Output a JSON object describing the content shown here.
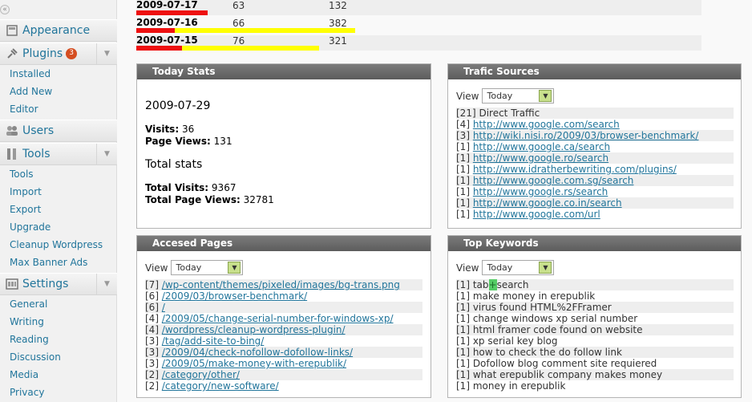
{
  "sidebar": {
    "collapse_icon": "«",
    "menus": [
      {
        "label": "Appearance",
        "icon": "appearance-icon"
      },
      {
        "label": "Plugins",
        "icon": "plugins-icon",
        "badge": "3"
      },
      {
        "label": "Users",
        "icon": "users-icon"
      },
      {
        "label": "Tools",
        "icon": "tools-icon"
      },
      {
        "label": "Settings",
        "icon": "settings-icon"
      }
    ],
    "plugins_sub": [
      "Installed",
      "Add New",
      "Editor"
    ],
    "tools_sub": [
      "Tools",
      "Import",
      "Export",
      "Upgrade",
      "Cleanup Wordpress",
      "Max Banner Ads"
    ],
    "settings_sub": [
      "General",
      "Writing",
      "Reading",
      "Discussion",
      "Media",
      "Privacy"
    ]
  },
  "daily_rows": [
    {
      "date": "2009-07-17",
      "visits": "63",
      "views": "132",
      "visits_frac": 0.195,
      "views_frac": 0.195
    },
    {
      "date": "2009-07-16",
      "visits": "66",
      "views": "382",
      "visits_frac": 0.105,
      "views_frac": 0.6
    },
    {
      "date": "2009-07-15",
      "visits": "76",
      "views": "321",
      "visits_frac": 0.125,
      "views_frac": 0.5
    }
  ],
  "today": {
    "title": "Today Stats",
    "date": "2009-07-29",
    "visits_label": "Visits:",
    "visits": "36",
    "views_label": "Page Views:",
    "views": "131",
    "total_heading": "Total stats",
    "total_visits_label": "Total Visits:",
    "total_visits": "9367",
    "total_views_label": "Total Page Views:",
    "total_views": "32781"
  },
  "traffic": {
    "title": "Trafic Sources",
    "view_label": "View",
    "select_value": "Today",
    "direct": "[21] Direct Traffic",
    "items": [
      {
        "count": "[4]",
        "url": "http://www.google.com/search"
      },
      {
        "count": "[3]",
        "url": "http://wiki.nisi.ro/2009/03/browser-benchmark/"
      },
      {
        "count": "[1]",
        "url": "http://www.google.ca/search"
      },
      {
        "count": "[1]",
        "url": "http://www.google.ro/search"
      },
      {
        "count": "[1]",
        "url": "http://www.idratherbewriting.com/plugins/"
      },
      {
        "count": "[1]",
        "url": "http://www.google.com.sg/search"
      },
      {
        "count": "[1]",
        "url": "http://www.google.rs/search"
      },
      {
        "count": "[1]",
        "url": "http://www.google.co.in/search"
      },
      {
        "count": "[1]",
        "url": "http://www.google.com/url"
      }
    ]
  },
  "pages": {
    "title": "Accesed Pages",
    "view_label": "View",
    "select_value": "Today",
    "items": [
      {
        "count": "[7]",
        "url": "/wp-content/themes/pixeled/images/bg-trans.png"
      },
      {
        "count": "[6]",
        "url": "/2009/03/browser-benchmark/"
      },
      {
        "count": "[6]",
        "url": "/"
      },
      {
        "count": "[4]",
        "url": "/2009/05/change-serial-number-for-windows-xp/"
      },
      {
        "count": "[4]",
        "url": "/wordpress/cleanup-wordpress-plugin/"
      },
      {
        "count": "[3]",
        "url": "/tag/add-site-to-bing/"
      },
      {
        "count": "[3]",
        "url": "/2009/04/check-nofollow-dofollow-links/"
      },
      {
        "count": "[3]",
        "url": "/2009/05/make-money-with-erepublik/"
      },
      {
        "count": "[2]",
        "url": "/category/other/"
      },
      {
        "count": "[2]",
        "url": "/category/new-software/"
      }
    ]
  },
  "keywords": {
    "title": "Top Keywords",
    "view_label": "View",
    "select_value": "Today",
    "first_prefix": "[1] tab",
    "first_hl": "+",
    "first_suffix": "search",
    "items": [
      "[1] make money in erepublik",
      "[1] virus found HTML%2FFramer",
      "[1] change windows xp serial number",
      "[1] html framer code found on website",
      "[1] xp serial key blog",
      "[1] how to check the do follow link",
      "[1] Dofollow blog comment site requiered",
      "[1] what erepublik company makes money",
      "[1] money in erepublik"
    ]
  },
  "colors": {
    "visits_bar": "#ee1111",
    "views_bar": "#ffff00",
    "link": "#21759b"
  }
}
